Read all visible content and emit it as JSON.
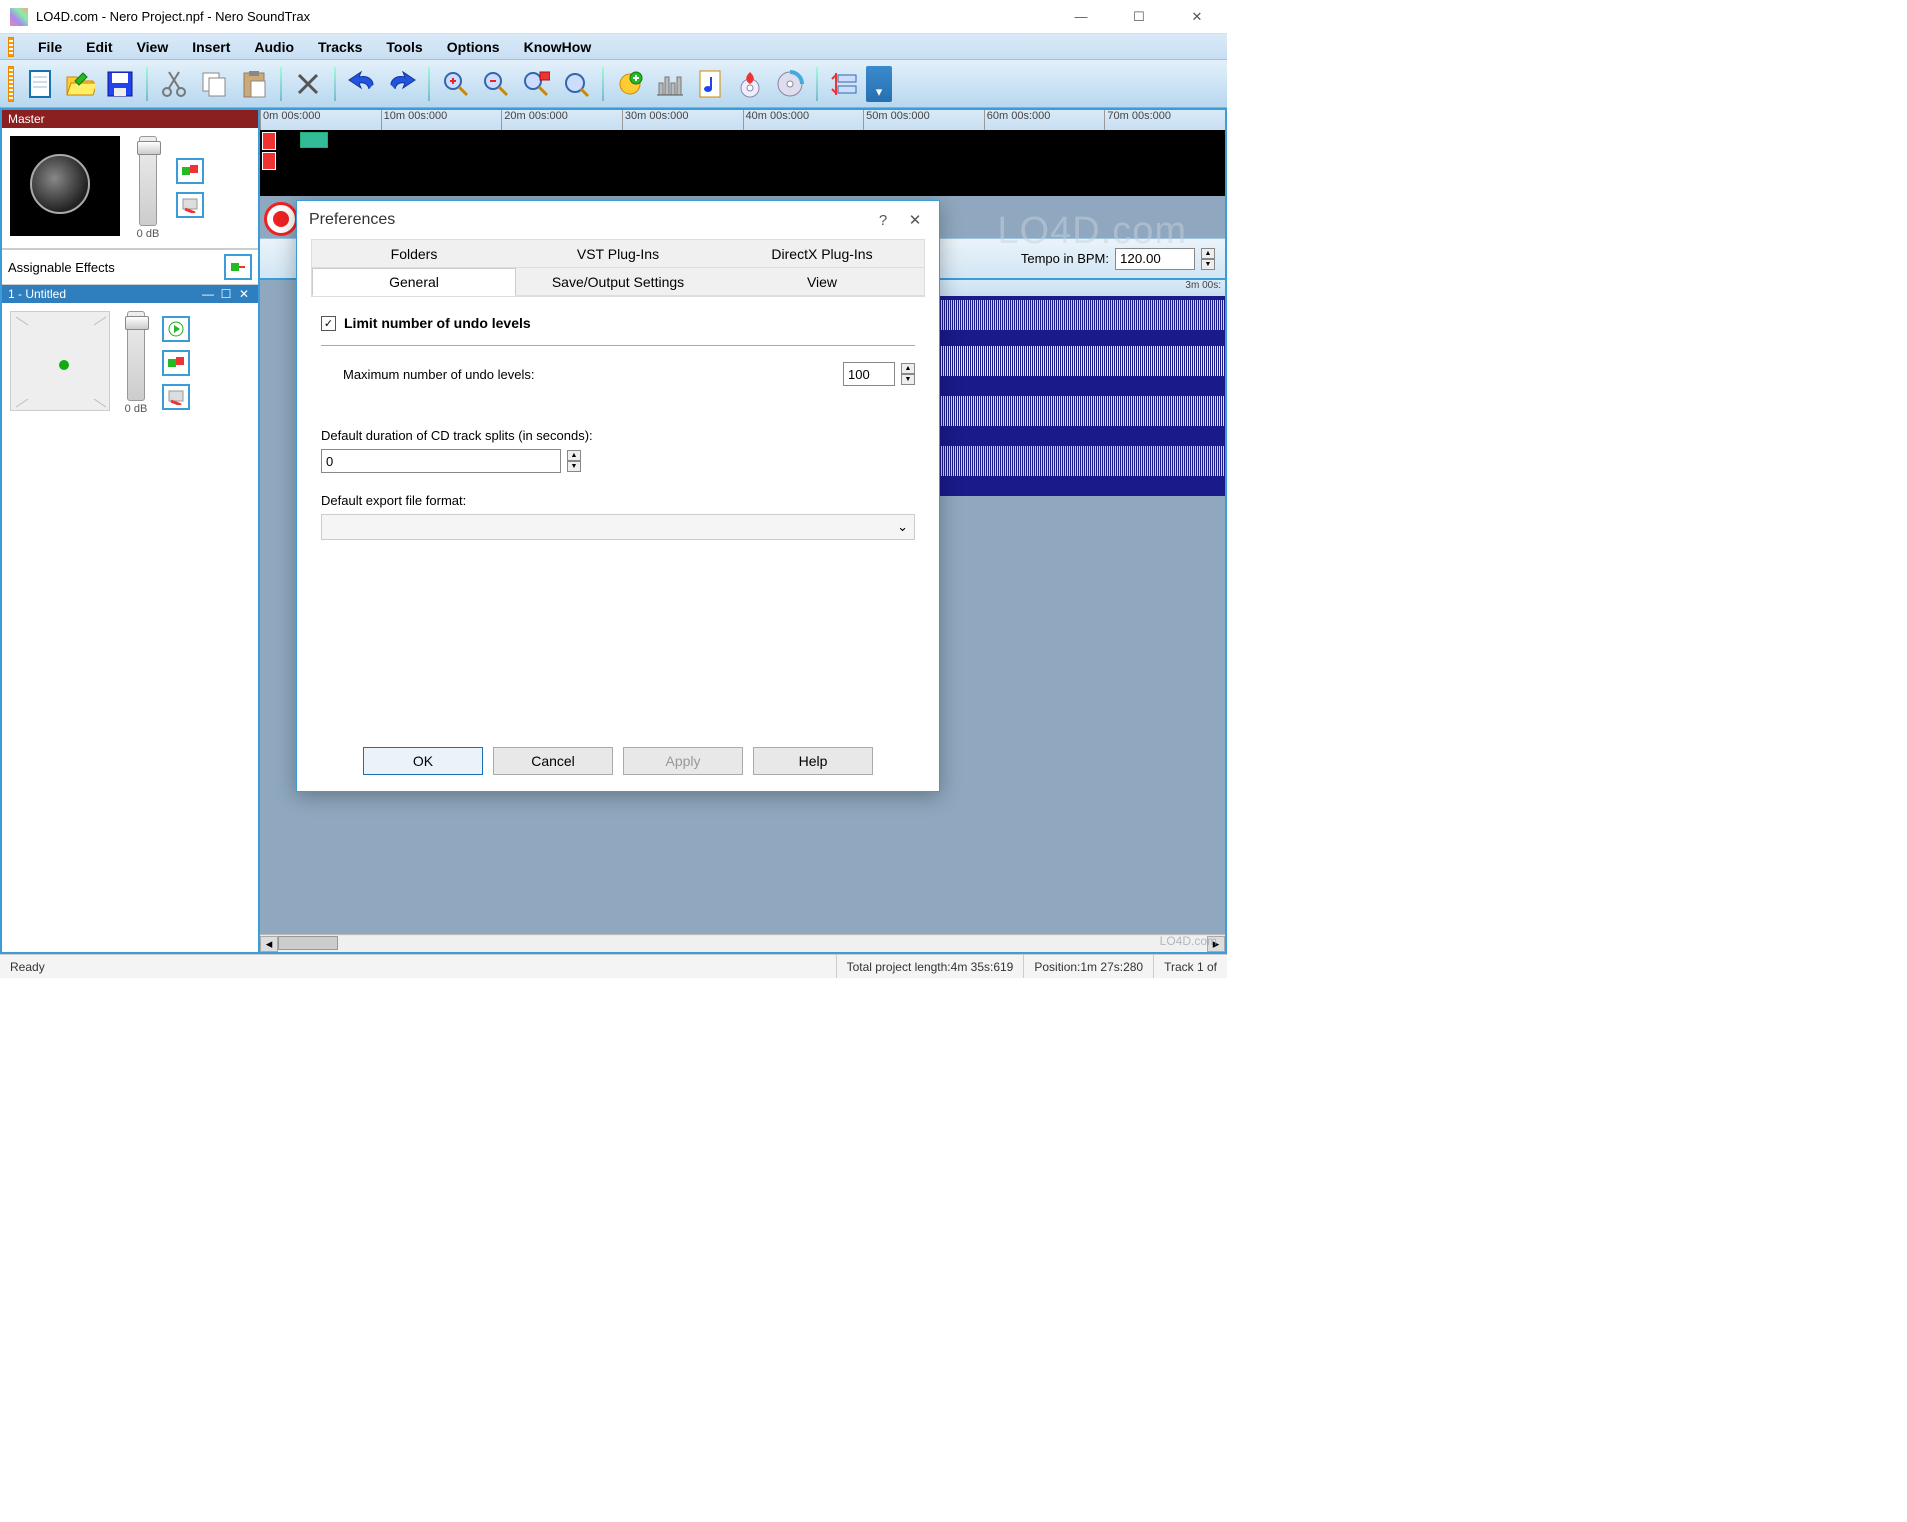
{
  "window": {
    "title": "LO4D.com - Nero Project.npf - Nero SoundTrax"
  },
  "menu": {
    "items": [
      "File",
      "Edit",
      "View",
      "Insert",
      "Audio",
      "Tracks",
      "Tools",
      "Options",
      "KnowHow"
    ]
  },
  "toolbar": {
    "icons": [
      "new-file",
      "open-folder",
      "save-disk",
      "cut",
      "copy",
      "paste",
      "delete",
      "undo",
      "redo",
      "zoom-in",
      "zoom-out",
      "zoom-sel",
      "zoom-fit",
      "add-fx",
      "mixer",
      "note",
      "burn",
      "cd",
      "align"
    ]
  },
  "master": {
    "label": "Master",
    "db": "0 dB"
  },
  "effects": {
    "label": "Assignable Effects"
  },
  "track1": {
    "label": "1 - Untitled",
    "db": "0 dB"
  },
  "timeline": {
    "ticks": [
      "0m 00s:000",
      "10m 00s:000",
      "20m 00s:000",
      "30m 00s:000",
      "40m 00s:000",
      "50m 00s:000",
      "60m 00s:000",
      "70m 00s:000"
    ]
  },
  "tempo": {
    "label": "Tempo in BPM:",
    "value": "120.00"
  },
  "waveruler": {
    "label": "3m 00s:"
  },
  "status": {
    "ready": "Ready",
    "length": "Total project length:4m 35s:619",
    "position": "Position:1m 27s:280",
    "track": "Track 1 of"
  },
  "dialog": {
    "title": "Preferences",
    "tabs_row1": [
      "Folders",
      "VST Plug-Ins",
      "DirectX Plug-Ins"
    ],
    "tabs_row2": [
      "General",
      "Save/Output Settings",
      "View"
    ],
    "active_tab": "General",
    "limit_undo_label": "Limit number of undo levels",
    "max_undo_label": "Maximum number of undo levels:",
    "max_undo_value": "100",
    "cd_split_label": "Default duration of CD track splits (in seconds):",
    "cd_split_value": "0",
    "export_label": "Default export file format:",
    "export_value": "",
    "btn_ok": "OK",
    "btn_cancel": "Cancel",
    "btn_apply": "Apply",
    "btn_help": "Help"
  },
  "watermark": "LO4D.com",
  "watermark2": "LO4D.com"
}
